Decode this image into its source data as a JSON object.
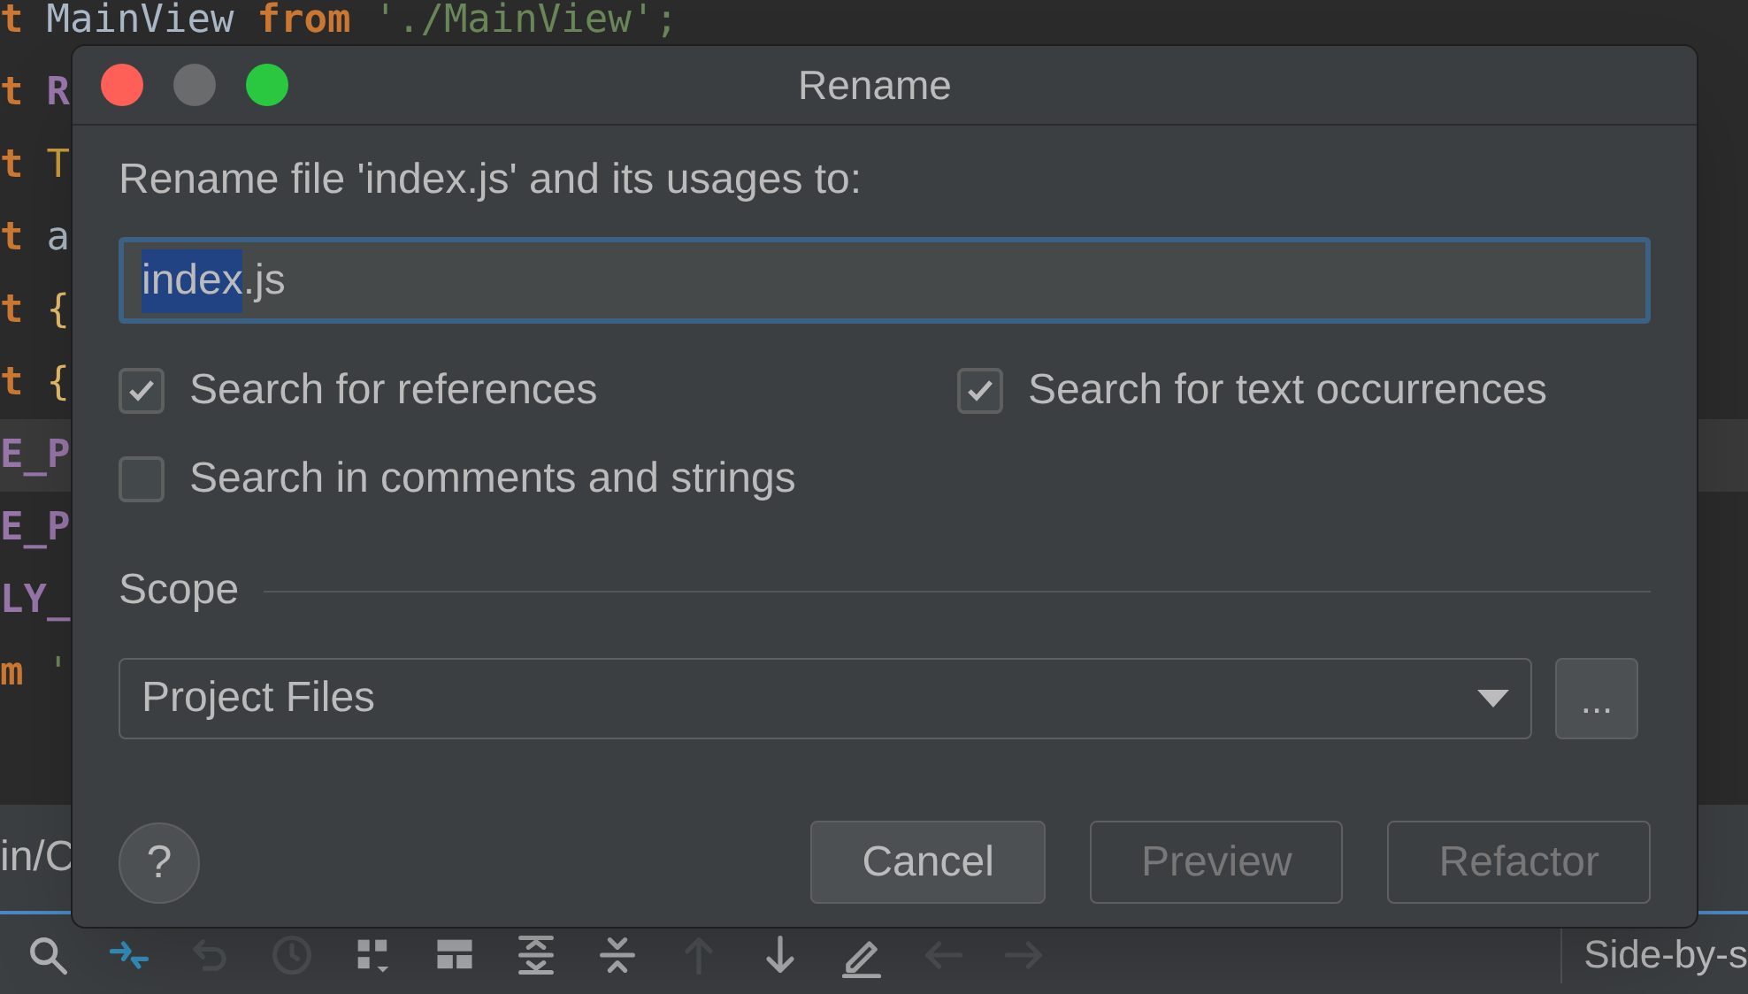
{
  "editor": {
    "lines": [
      {
        "current": false,
        "segments": [
          {
            "kind": "keyword",
            "text": "t"
          },
          {
            "kind": "plain",
            "text": "MainView"
          },
          {
            "kind": "keyword",
            "text": "from"
          },
          {
            "kind": "string",
            "text": "'./MainView';"
          }
        ]
      },
      {
        "current": false,
        "segments": [
          {
            "kind": "keyword",
            "text": "t"
          },
          {
            "kind": "constant",
            "text": "R"
          }
        ]
      },
      {
        "current": false,
        "segments": [
          {
            "kind": "keyword",
            "text": "t"
          },
          {
            "kind": "type",
            "text": "T"
          }
        ]
      },
      {
        "current": false,
        "segments": [
          {
            "kind": "keyword",
            "text": "t"
          },
          {
            "kind": "plain",
            "text": "a"
          }
        ]
      },
      {
        "current": false,
        "segments": [
          {
            "kind": "keyword",
            "text": "t"
          },
          {
            "kind": "brace",
            "text": "{"
          }
        ]
      },
      {
        "current": false,
        "segments": [
          {
            "kind": "keyword",
            "text": "t"
          },
          {
            "kind": "brace",
            "text": "{"
          }
        ]
      },
      {
        "current": true,
        "segments": [
          {
            "kind": "constant",
            "text": "E_P"
          }
        ]
      },
      {
        "current": false,
        "segments": [
          {
            "kind": "constant",
            "text": "E_P"
          }
        ]
      },
      {
        "current": false,
        "segments": [
          {
            "kind": "constant",
            "text": "LY_"
          }
        ]
      },
      {
        "current": false,
        "segments": [
          {
            "kind": "keyword",
            "text": "m"
          },
          {
            "kind": "string",
            "text": "'"
          }
        ]
      }
    ]
  },
  "tab_bar": {
    "tab": "in/C"
  },
  "toolbar": {
    "items": [
      {
        "kind": "search",
        "disabled": false
      },
      {
        "kind": "merge",
        "disabled": false,
        "highlight": true
      },
      {
        "kind": "undo",
        "disabled": true
      },
      {
        "kind": "history",
        "disabled": true
      },
      {
        "kind": "grid",
        "disabled": false
      },
      {
        "kind": "layout",
        "disabled": false
      },
      {
        "kind": "expand",
        "disabled": false
      },
      {
        "kind": "collapse",
        "disabled": false
      },
      {
        "kind": "up",
        "disabled": true
      },
      {
        "kind": "down",
        "disabled": false
      },
      {
        "kind": "edit",
        "disabled": false
      },
      {
        "kind": "left",
        "disabled": true
      },
      {
        "kind": "right",
        "disabled": true
      }
    ],
    "viewer": "Side-by-s"
  },
  "dialog": {
    "title": "Rename",
    "prompt": "Rename file 'index.js' and its usages to:",
    "field": {
      "selected_text": "index",
      "rest_text": ".js"
    },
    "options": [
      {
        "label": "Search for references",
        "checked": true
      },
      {
        "label": "Search for text occurrences",
        "checked": true
      },
      {
        "label": "Search in comments and strings",
        "checked": false
      }
    ],
    "scope": {
      "label": "Scope",
      "value": "Project Files",
      "more": "..."
    },
    "help": "?",
    "buttons": [
      {
        "label": "Cancel",
        "disabled": false
      },
      {
        "label": "Preview",
        "disabled": true
      },
      {
        "label": "Refactor",
        "disabled": true
      }
    ]
  }
}
